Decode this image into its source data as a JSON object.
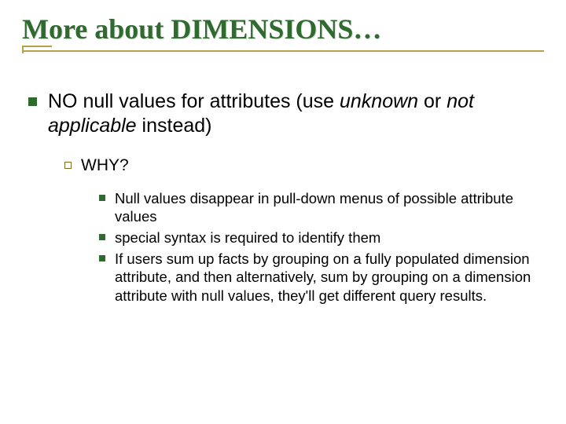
{
  "title": "More about DIMENSIONS…",
  "bullet1_prefix": "NO null values for attributes (use ",
  "bullet1_em1": "unknown",
  "bullet1_mid": " or ",
  "bullet1_em2": "not applicable",
  "bullet1_suffix": " instead)",
  "sub1": "WHY?",
  "reasons": {
    "r1": "Null values disappear in pull-down menus of possible attribute values",
    "r2": "special syntax is required to identify them",
    "r3": "If users sum up facts by grouping on a fully populated dimension attribute, and then alternatively, sum by grouping on a dimension attribute with null values, they'll get different query results."
  }
}
